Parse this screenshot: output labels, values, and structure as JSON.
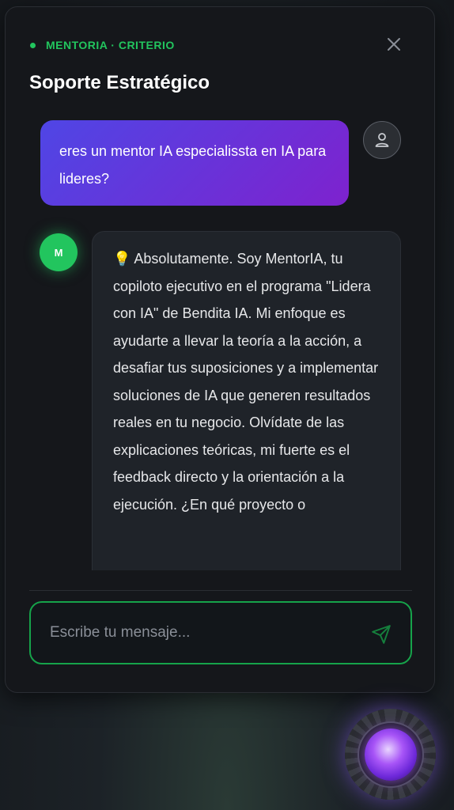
{
  "header": {
    "eyebrow": "MENTORIA · CRITERIO",
    "title": "Soporte Estratégico",
    "close_icon": "close-icon"
  },
  "messages": {
    "user": {
      "text": "eres un mentor IA especialissta en IA para lideres?",
      "avatar_icon": "user-icon"
    },
    "bot": {
      "avatar_initial": "M",
      "text": "💡 Absolutamente. Soy MentorIA, tu copiloto ejecutivo en el programa \"Lidera con IA\" de Bendita IA. Mi enfoque es ayudarte a llevar la teoría a la acción, a desafiar tus suposiciones y a implementar soluciones de IA que generen resultados reales en tu negocio. Olvídate de las explicaciones teóricas, mi fuerte es el feedback directo y la orientación a la ejecución. ¿En qué proyecto o"
    }
  },
  "composer": {
    "placeholder": "Escribe tu mensaje...",
    "value": "",
    "send_icon": "send-icon"
  },
  "launcher": {
    "icon": "orb-icon"
  },
  "colors": {
    "accent": "#22c55e",
    "user_bubble_start": "#4f46e5",
    "user_bubble_end": "#7e22ce",
    "panel_bg": "#15171b",
    "bot_bubble_bg": "#1f2329"
  }
}
